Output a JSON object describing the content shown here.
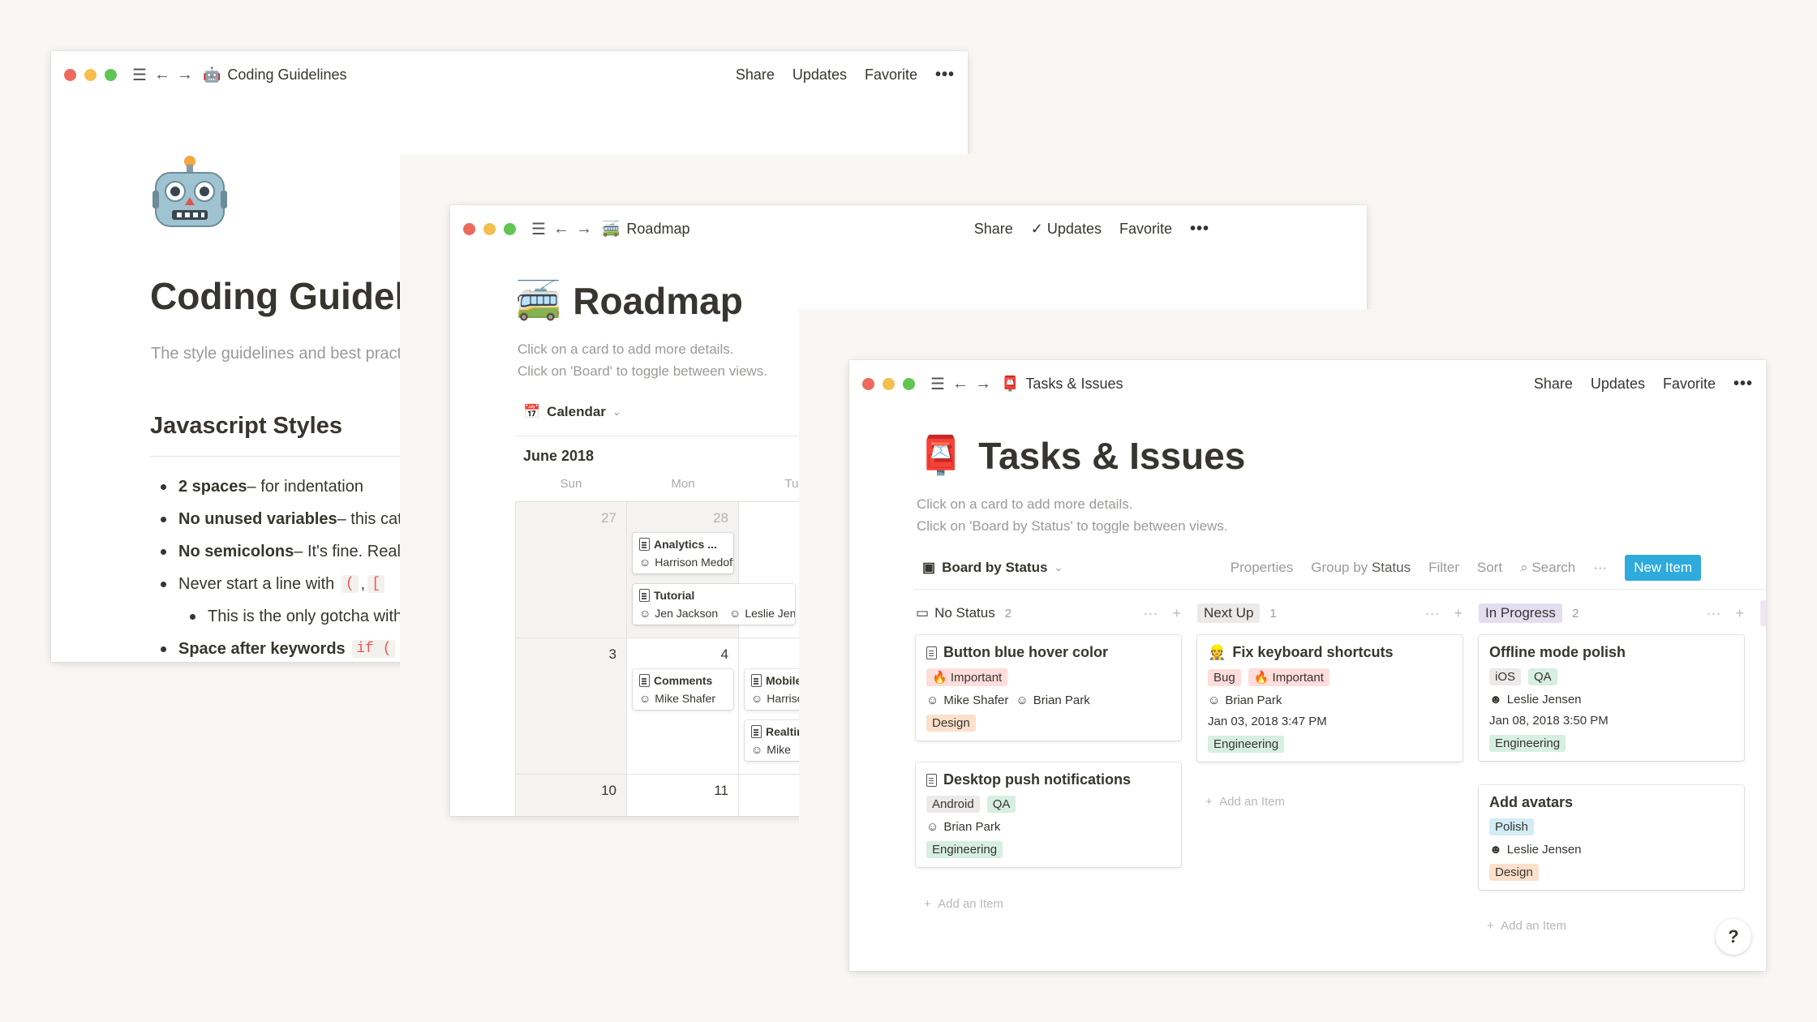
{
  "colors": {
    "accent": "#2eaadc",
    "code_red": "#eb5757"
  },
  "windows": {
    "coding": {
      "title": "Coding Guidelines",
      "title_icon": "🤖",
      "page_icon": "robot-icon",
      "nav": {
        "share": "Share",
        "updates": "Updates",
        "favorite": "Favorite",
        "more": "•••"
      },
      "heading": "Coding Guidelines",
      "subtitle": "The style guidelines and best practices",
      "section": "Javascript Styles",
      "items": [
        {
          "bold": "2 spaces",
          "text": " – for indentation"
        },
        {
          "bold": "No unused variables",
          "text": " – this catches typos"
        },
        {
          "bold": "No semicolons",
          "text": " – It's fine. Really!"
        },
        {
          "text": "Never start a line with",
          "code1": "(",
          "sep": ",",
          "code2": "["
        },
        {
          "text": "This is the only gotcha with omitting semicolons"
        },
        {
          "bold": "Space after keywords",
          "code": "if ("
        }
      ]
    },
    "roadmap": {
      "title": "Roadmap",
      "title_icon": "🚎",
      "nav": {
        "share": "Share",
        "updates": "Updates",
        "favorite": "Favorite",
        "more": "•••"
      },
      "heading": "Roadmap",
      "sub1": "Click on a card to add more details.",
      "sub2": "Click on 'Board' to toggle between views.",
      "view": "Calendar",
      "month": "June 2018",
      "weekdays": [
        "Sun",
        "Mon",
        "Tue"
      ],
      "days": [
        "27",
        "28",
        "3",
        "4",
        "10",
        "11"
      ],
      "cards": [
        {
          "title": "Analytics ...",
          "person": "Harrison Medoff"
        },
        {
          "title": "Tutorial",
          "person": "Jen Jackson",
          "person2": "Leslie Jensen"
        },
        {
          "title": "Comments",
          "person": "Mike Shafer"
        },
        {
          "title": "Mobile",
          "person": "Harrison"
        },
        {
          "title": "Realtime",
          "person": "Mike"
        }
      ]
    },
    "tasks": {
      "title": "Tasks & Issues",
      "title_icon": "📮",
      "nav": {
        "share": "Share",
        "updates": "Updates",
        "favorite": "Favorite",
        "more": "•••"
      },
      "heading": "Tasks & Issues",
      "sub1": "Click on a card to add more details.",
      "sub2": "Click on 'Board by Status' to toggle between views.",
      "view": "Board by Status",
      "tools": {
        "properties": "Properties",
        "group_by": "Group by",
        "group_val": "Status",
        "filter": "Filter",
        "sort": "Sort",
        "search": "Search",
        "more": "···",
        "new_item": "New Item"
      },
      "add_item": "Add an Item",
      "help": "?",
      "columns": [
        {
          "name": "No Status",
          "count": "2"
        },
        {
          "name": "Next Up",
          "count": "1"
        },
        {
          "name": "In Progress",
          "count": "2"
        }
      ],
      "cards": {
        "c1": {
          "title": "Button blue hover color",
          "tag": "🔥 Important",
          "p1": "Mike Shafer",
          "p2": "Brian Park",
          "tag2": "Design"
        },
        "c2": {
          "title": "Desktop push notifications",
          "tag1": "Android",
          "tag2": "QA",
          "p1": "Brian Park",
          "tag3": "Engineering"
        },
        "c3": {
          "title": "Fix keyboard shortcuts",
          "tag1": "Bug",
          "tag2": "🔥 Important",
          "p1": "Brian Park",
          "date": "Jan 03, 2018 3:47 PM",
          "tag3": "Engineering"
        },
        "c4": {
          "title": "Offline mode polish",
          "tag1": "iOS",
          "tag2": "QA",
          "p1": "Leslie Jensen",
          "date": "Jan 08, 2018 3:50 PM",
          "tag3": "Engineering"
        },
        "c5": {
          "title": "Add avatars",
          "tag1": "Polish",
          "p1": "Leslie Jensen",
          "tag2": "Design"
        }
      }
    }
  }
}
